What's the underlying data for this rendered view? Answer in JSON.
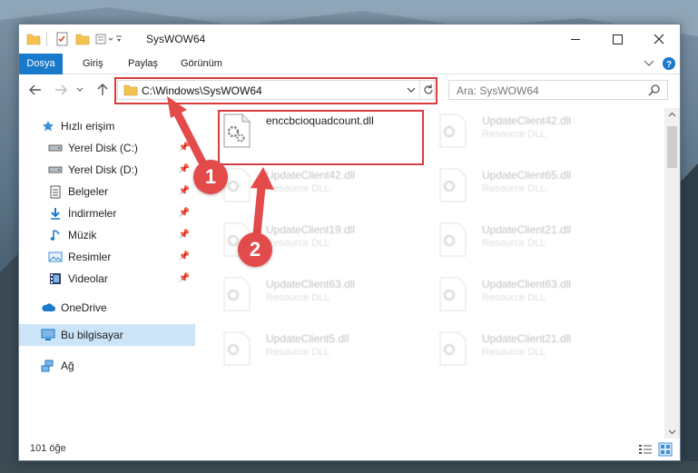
{
  "window": {
    "title": "SysWOW64"
  },
  "ribbon": {
    "tabs": [
      "Dosya",
      "Giriş",
      "Paylaş",
      "Görünüm"
    ]
  },
  "navigation": {
    "address": "C:\\Windows\\SysWOW64",
    "search_placeholder": "Ara: SysWOW64"
  },
  "sidebar": {
    "items": [
      {
        "label": "Hızlı erişim",
        "icon": "star-icon",
        "pinned": false
      },
      {
        "label": "Yerel Disk (C:)",
        "icon": "drive-icon",
        "pinned": true
      },
      {
        "label": "Yerel Disk (D:)",
        "icon": "drive-icon",
        "pinned": true
      },
      {
        "label": "Belgeler",
        "icon": "document-icon",
        "pinned": true
      },
      {
        "label": "İndirmeler",
        "icon": "download-icon",
        "pinned": true
      },
      {
        "label": "Müzik",
        "icon": "music-icon",
        "pinned": true
      },
      {
        "label": "Resimler",
        "icon": "pictures-icon",
        "pinned": true
      },
      {
        "label": "Videolar",
        "icon": "video-icon",
        "pinned": true
      },
      {
        "label": "OneDrive",
        "icon": "cloud-icon",
        "pinned": false
      },
      {
        "label": "Bu bilgisayar",
        "icon": "computer-icon",
        "pinned": false
      },
      {
        "label": "Ağ",
        "icon": "network-icon",
        "pinned": false
      }
    ]
  },
  "files": [
    {
      "name": "enccbcioquadcount.dll",
      "type": ""
    },
    {
      "name": "UpdateClient42.dll",
      "type": "Resource DLL"
    },
    {
      "name": "UpdateClient42.dll",
      "type": "Resource DLL"
    },
    {
      "name": "UpdateClient65.dll",
      "type": "Resource DLL"
    },
    {
      "name": "UpdateClient19.dll",
      "type": "Resource DLL"
    },
    {
      "name": "UpdateClient21.dll",
      "type": "Resource DLL"
    },
    {
      "name": "UpdateClient63.dll",
      "type": "Resource DLL"
    },
    {
      "name": "UpdateClient63.dll",
      "type": "Resource DLL"
    },
    {
      "name": "UpdateClient5.dll",
      "type": "Resource DLL"
    },
    {
      "name": "UpdateClient21.dll",
      "type": "Resource DLL"
    }
  ],
  "status": {
    "item_count": "101 öğe"
  },
  "annotations": {
    "step1": "1",
    "step2": "2"
  },
  "colors": {
    "accent": "#1979ca",
    "highlight": "#d83c3c",
    "selection": "#cce4f7"
  }
}
